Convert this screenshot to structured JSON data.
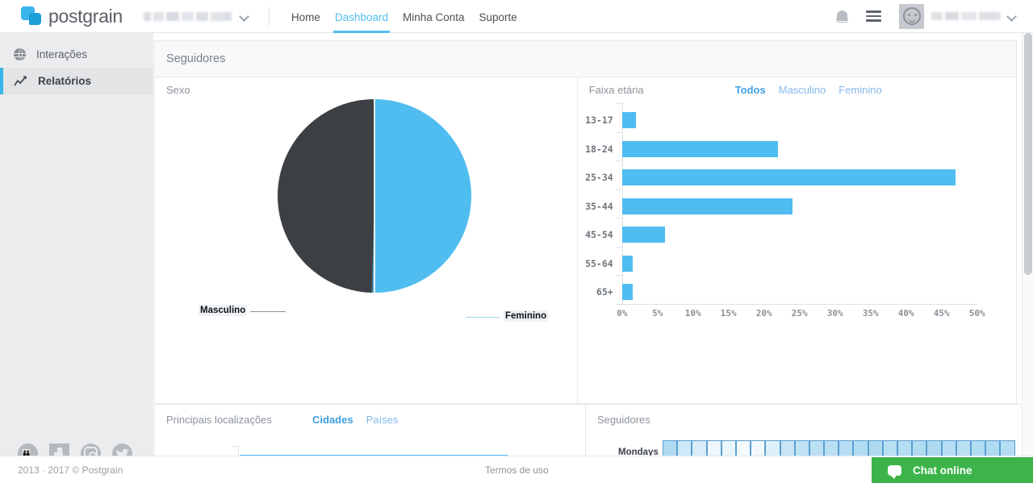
{
  "brand": {
    "name": "postgrain",
    "logo_icon": "postgrain-logo-icon"
  },
  "topnav": {
    "account_selector": {
      "value": "",
      "icon": "chevron-down-icon"
    },
    "links": [
      {
        "label": "Home",
        "active": false
      },
      {
        "label": "Dashboard",
        "active": true
      },
      {
        "label": "Minha Conta",
        "active": false
      },
      {
        "label": "Suporte",
        "active": false
      }
    ],
    "notifications_icon": "bell-icon",
    "menu_icon": "hamburger-menu-icon",
    "avatar_icon": "smiley-face-avatar-icon",
    "username": "",
    "user_chevron_icon": "chevron-down-icon"
  },
  "sidebar": {
    "items": [
      {
        "label": "Interações",
        "icon": "globe-icon",
        "active": false
      },
      {
        "label": "Relatórios",
        "icon": "line-chart-icon",
        "active": true
      }
    ],
    "social": [
      {
        "name": "group-icon"
      },
      {
        "name": "facebook-icon"
      },
      {
        "name": "instagram-icon"
      },
      {
        "name": "twitter-icon"
      }
    ]
  },
  "card": {
    "title": "Seguidores",
    "sex_panel": {
      "title": "Sexo"
    },
    "age_panel": {
      "title": "Faixa etária",
      "tabs": [
        {
          "label": "Todos",
          "active": true
        },
        {
          "label": "Masculino",
          "active": false
        },
        {
          "label": "Feminino",
          "active": false
        }
      ]
    }
  },
  "bottom": {
    "locations": {
      "title": "Principais localizações",
      "tabs": [
        {
          "label": "Cidades",
          "active": true
        },
        {
          "label": "Países",
          "active": false
        }
      ]
    },
    "followers": {
      "title": "Seguidores",
      "row_label": "Mondays"
    }
  },
  "footer": {
    "copyright": "2013 · 2017 © Postgrain",
    "terms": "Termos de uso",
    "chat": {
      "label": "Chat online",
      "icon": "chat-bubble-icon",
      "color": "#3cb44a"
    }
  },
  "colors": {
    "accent_blue": "#4fbdf0",
    "nav_active": "#4fc0ef",
    "dark_slice": "#3c3f43",
    "sidebar_bg": "#ebecee",
    "chat_green": "#3cb44a"
  },
  "chart_data": [
    {
      "type": "pie",
      "title": "Sexo",
      "labels": [
        "Feminino",
        "Masculino"
      ],
      "values": [
        50.4,
        49.6
      ],
      "colors": [
        "#4fbdf0",
        "#3c3f43"
      ],
      "legend": "labels-outside-with-leader-lines"
    },
    {
      "type": "bar",
      "orientation": "horizontal",
      "title": "Faixa etária",
      "categories": [
        "13-17",
        "18-24",
        "25-34",
        "35-44",
        "45-54",
        "55-64",
        "65+"
      ],
      "values": [
        2,
        22,
        47,
        24,
        6,
        1.5,
        1.5
      ],
      "xlabel": "",
      "ylabel": "",
      "xlim": [
        0,
        50
      ],
      "xticks": [
        "0%",
        "5%",
        "10%",
        "15%",
        "20%",
        "25%",
        "30%",
        "35%",
        "40%",
        "45%",
        "50%"
      ],
      "series_color": "#4fbdf0",
      "grid": false,
      "legend": "none"
    },
    {
      "type": "heatmap",
      "title": "Seguidores",
      "rows": [
        "Mondays"
      ],
      "values": [
        [
          0.62,
          0.38,
          0.3,
          0.14,
          0.16,
          0.08,
          0.1,
          0.26,
          0.44,
          0.5,
          0.52,
          0.55,
          0.58,
          0.6,
          0.62,
          0.55,
          0.58,
          0.6,
          0.62,
          0.58,
          0.55,
          0.6,
          0.62,
          0.58
        ]
      ],
      "color_low": "#ffffff",
      "color_high": "#7fc4ea"
    },
    {
      "type": "bar",
      "orientation": "horizontal",
      "title": "Principais localizações",
      "categories": [
        ""
      ],
      "values": [
        100
      ],
      "series_color": "#4fbdf0"
    }
  ]
}
